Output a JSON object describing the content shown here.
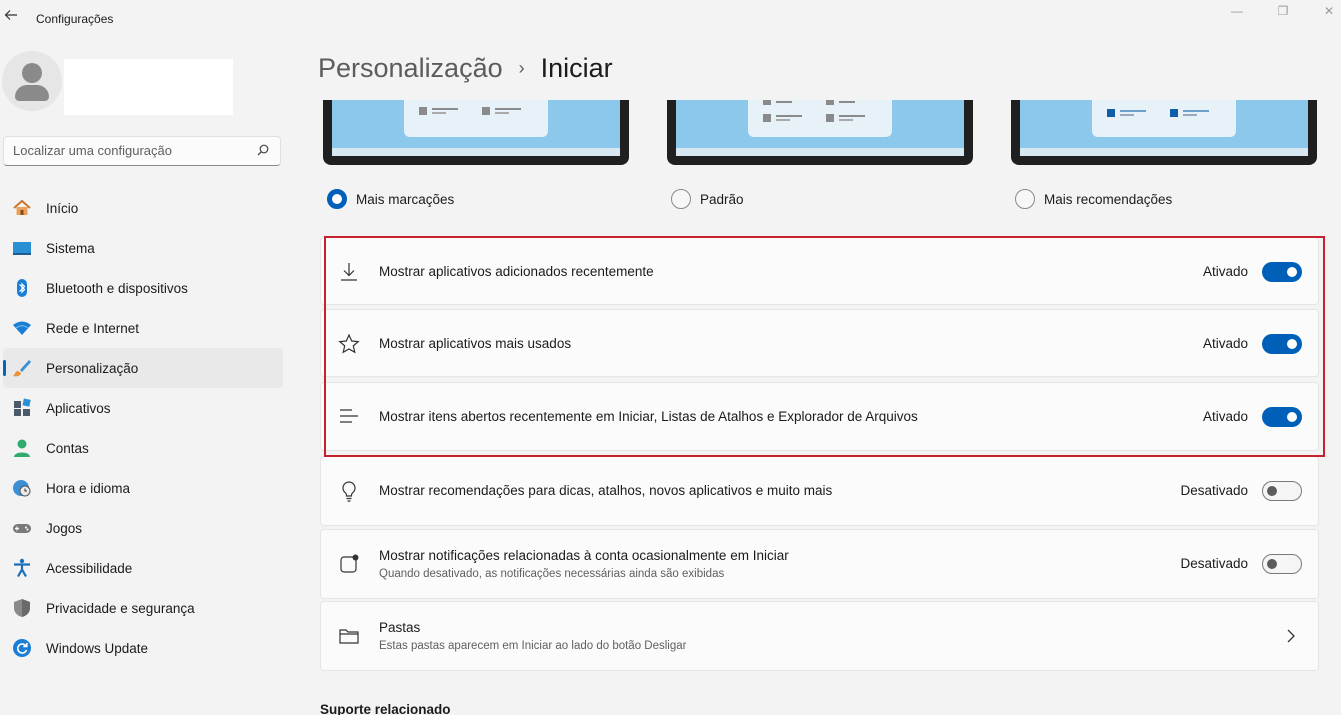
{
  "window": {
    "title": "Configurações",
    "back_icon": "back-arrow-icon",
    "minimize": "—",
    "maximize": "❐",
    "close": "✕"
  },
  "search": {
    "placeholder": "Localizar uma configuração",
    "value": ""
  },
  "nav": {
    "items": [
      {
        "label": "Início",
        "icon": "home-icon"
      },
      {
        "label": "Sistema",
        "icon": "monitor-icon"
      },
      {
        "label": "Bluetooth e dispositivos",
        "icon": "bluetooth-icon"
      },
      {
        "label": "Rede e Internet",
        "icon": "wifi-icon"
      },
      {
        "label": "Personalização",
        "icon": "brush-icon",
        "active": true
      },
      {
        "label": "Aplicativos",
        "icon": "apps-icon"
      },
      {
        "label": "Contas",
        "icon": "person-icon"
      },
      {
        "label": "Hora e idioma",
        "icon": "globe-clock-icon"
      },
      {
        "label": "Jogos",
        "icon": "gamepad-icon"
      },
      {
        "label": "Acessibilidade",
        "icon": "accessibility-icon"
      },
      {
        "label": "Privacidade e segurança",
        "icon": "shield-icon"
      },
      {
        "label": "Windows Update",
        "icon": "update-icon"
      }
    ]
  },
  "breadcrumb": {
    "parent": "Personalização",
    "separator": "›",
    "current": "Iniciar"
  },
  "layout_options": [
    {
      "label": "Mais marcações",
      "selected": true
    },
    {
      "label": "Padrão",
      "selected": false
    },
    {
      "label": "Mais recomendações",
      "selected": false
    }
  ],
  "settings": [
    {
      "title": "Mostrar aplicativos adicionados recentemente",
      "state": "Ativado",
      "on": true,
      "icon": "download-icon"
    },
    {
      "title": "Mostrar aplicativos mais usados",
      "state": "Ativado",
      "on": true,
      "icon": "star-icon"
    },
    {
      "title": "Mostrar itens abertos recentemente em Iniciar, Listas de Atalhos e Explorador de Arquivos",
      "state": "Ativado",
      "on": true,
      "icon": "list-lines-icon"
    },
    {
      "title": "Mostrar recomendações para dicas, atalhos, novos aplicativos e muito mais",
      "state": "Desativado",
      "on": false,
      "icon": "lightbulb-icon"
    },
    {
      "title": "Mostrar notificações relacionadas à conta ocasionalmente em Iniciar",
      "subtitle": "Quando desativado, as notificações necessárias ainda são exibidas",
      "state": "Desativado",
      "on": false,
      "icon": "notification-badge-icon"
    },
    {
      "title": "Pastas",
      "subtitle": "Estas pastas aparecem em Iniciar ao lado do botão Desligar",
      "icon": "folder-icon",
      "chevron_icon": "chevron-right-icon"
    }
  ],
  "related": {
    "heading": "Suporte relacionado"
  },
  "colors": {
    "accent": "#005fb8",
    "highlight_border": "#c4222e",
    "background": "#f3f3f3",
    "card": "#fbfbfb"
  }
}
